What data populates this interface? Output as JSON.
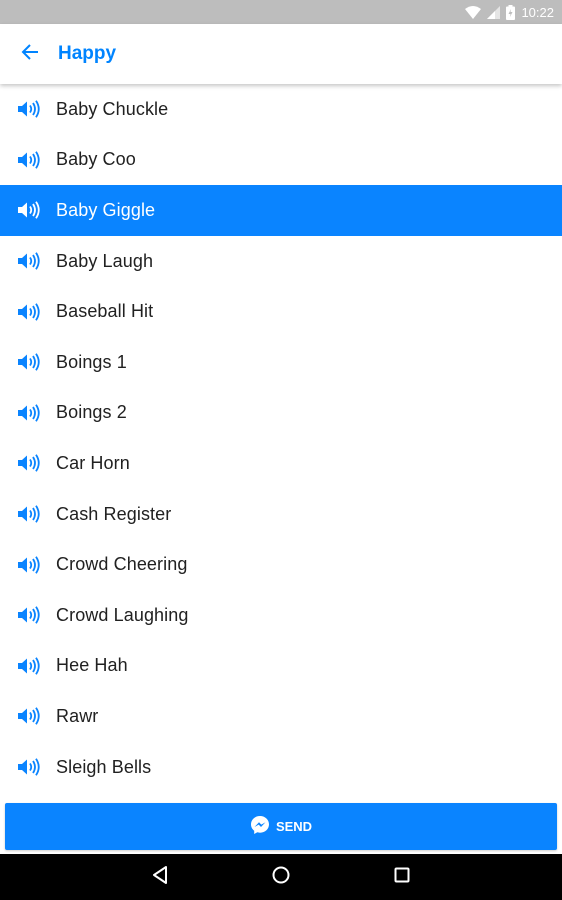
{
  "status_bar": {
    "time": "10:22"
  },
  "header": {
    "title": "Happy",
    "back_icon": "arrow-back-icon"
  },
  "colors": {
    "accent": "#0a84ff",
    "title": "#0084ff",
    "status_bar": "#bdbdbd"
  },
  "sounds": [
    {
      "label": "Baby Chuckle",
      "selected": false
    },
    {
      "label": "Baby Coo",
      "selected": false
    },
    {
      "label": "Baby Giggle",
      "selected": true
    },
    {
      "label": "Baby Laugh",
      "selected": false
    },
    {
      "label": "Baseball Hit",
      "selected": false
    },
    {
      "label": "Boings 1",
      "selected": false
    },
    {
      "label": "Boings 2",
      "selected": false
    },
    {
      "label": "Car Horn",
      "selected": false
    },
    {
      "label": "Cash Register",
      "selected": false
    },
    {
      "label": "Crowd Cheering",
      "selected": false
    },
    {
      "label": "Crowd Laughing",
      "selected": false
    },
    {
      "label": "Hee Hah",
      "selected": false
    },
    {
      "label": "Rawr",
      "selected": false
    },
    {
      "label": "Sleigh Bells",
      "selected": false
    }
  ],
  "send_button": {
    "label": "SEND",
    "icon": "messenger-icon"
  },
  "nav_bar": {
    "back": "nav-back-icon",
    "home": "nav-home-icon",
    "recents": "nav-recents-icon"
  }
}
